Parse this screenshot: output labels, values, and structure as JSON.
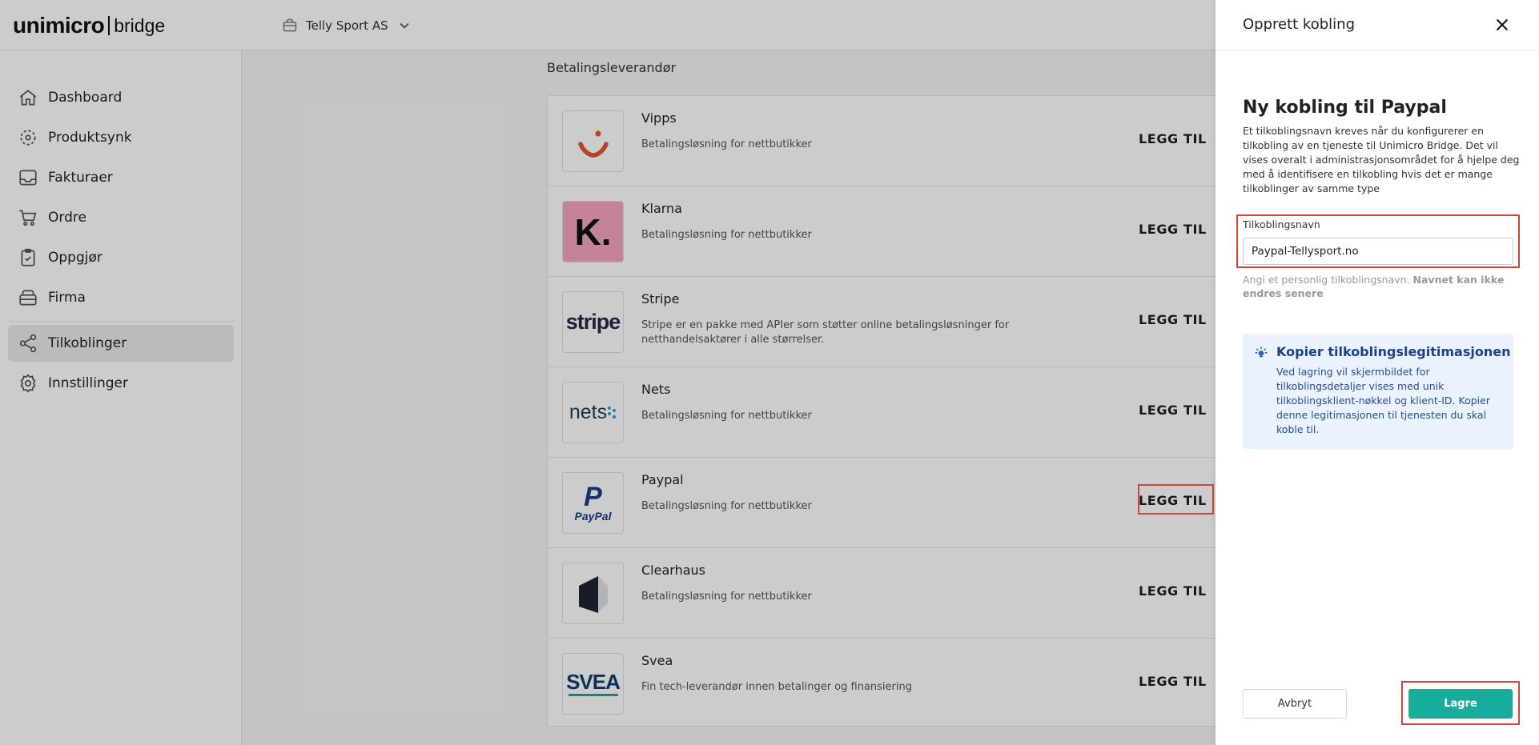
{
  "header": {
    "logo_brand": "unimicro",
    "logo_sub": "bridge",
    "company_name": "Telly Sport AS"
  },
  "sidebar": {
    "items": [
      {
        "label": "Dashboard",
        "icon": "home-icon"
      },
      {
        "label": "Produktsynk",
        "icon": "sync-icon"
      },
      {
        "label": "Fakturaer",
        "icon": "inbox-icon"
      },
      {
        "label": "Ordre",
        "icon": "cart-icon"
      },
      {
        "label": "Oppgjør",
        "icon": "clipboard-icon"
      },
      {
        "label": "Firma",
        "icon": "building-icon"
      },
      {
        "label": "Tilkoblinger",
        "icon": "share-icon",
        "active": true
      },
      {
        "label": "Innstillinger",
        "icon": "gear-icon"
      }
    ],
    "collapse_glyph": "«"
  },
  "main": {
    "section_title": "Betalingsleverandør",
    "add_label": "LEGG TIL",
    "providers": [
      {
        "name": "Vipps",
        "desc": "Betalingsløsning for nettbutikker"
      },
      {
        "name": "Klarna",
        "desc": "Betalingsløsning for nettbutikker"
      },
      {
        "name": "Stripe",
        "desc": "Stripe er en pakke med APIer som støtter online betalingsløsninger for netthandelsaktører i alle størrelser."
      },
      {
        "name": "Nets",
        "desc": "Betalingsløsning for nettbutikker"
      },
      {
        "name": "Paypal",
        "desc": "Betalingsløsning for nettbutikker"
      },
      {
        "name": "Clearhaus",
        "desc": "Betalingsløsning for nettbutikker"
      },
      {
        "name": "Svea",
        "desc": "Fin tech-leverandør innen betalinger og finansiering"
      }
    ],
    "logo_texts": {
      "klarna": "K.",
      "stripe": "stripe",
      "nets": "nets",
      "paypal_p": "P",
      "paypal_word": "PayPal",
      "svea": "SVEA"
    }
  },
  "drawer": {
    "title": "Opprett kobling",
    "heading": "Ny kobling til Paypal",
    "intro": "Et tilkoblingsnavn kreves når du konfigurerer en tilkobling av en tjeneste til Unimicro Bridge. Det vil vises overalt i administrasjonsområdet for å hjelpe deg med å identifisere en tilkobling hvis det er mange tilkoblinger av samme type",
    "field_label": "Tilkoblingsnavn",
    "field_value": "Paypal-Tellysport.no",
    "hint_normal": "Angi et personlig tilkoblingsnavn.",
    "hint_bold": "Navnet kan ikke endres senere",
    "info_title": "Kopier tilkoblingslegitimasjonen",
    "info_text": "Ved lagring vil skjermbildet for tilkoblingsdetaljer vises med unik tilkoblingsklient-nøkkel og klient-ID. Kopier denne legitimasjonen til tjenesten du skal koble til.",
    "cancel_label": "Avbryt",
    "save_label": "Lagre"
  },
  "colors": {
    "highlight": "#d0473a",
    "save_button": "#18ad9b",
    "info_bg": "#eaf3fd",
    "info_title": "#1e3f8a",
    "vipps": "#e0572b",
    "klarna_bg": "#f4a6c0",
    "stripe": "#222b4a",
    "nets": "#1c3f5a",
    "paypal_dark": "#1b3f8b",
    "paypal_light": "#2f9fd9",
    "svea": "#0f3e6e"
  }
}
